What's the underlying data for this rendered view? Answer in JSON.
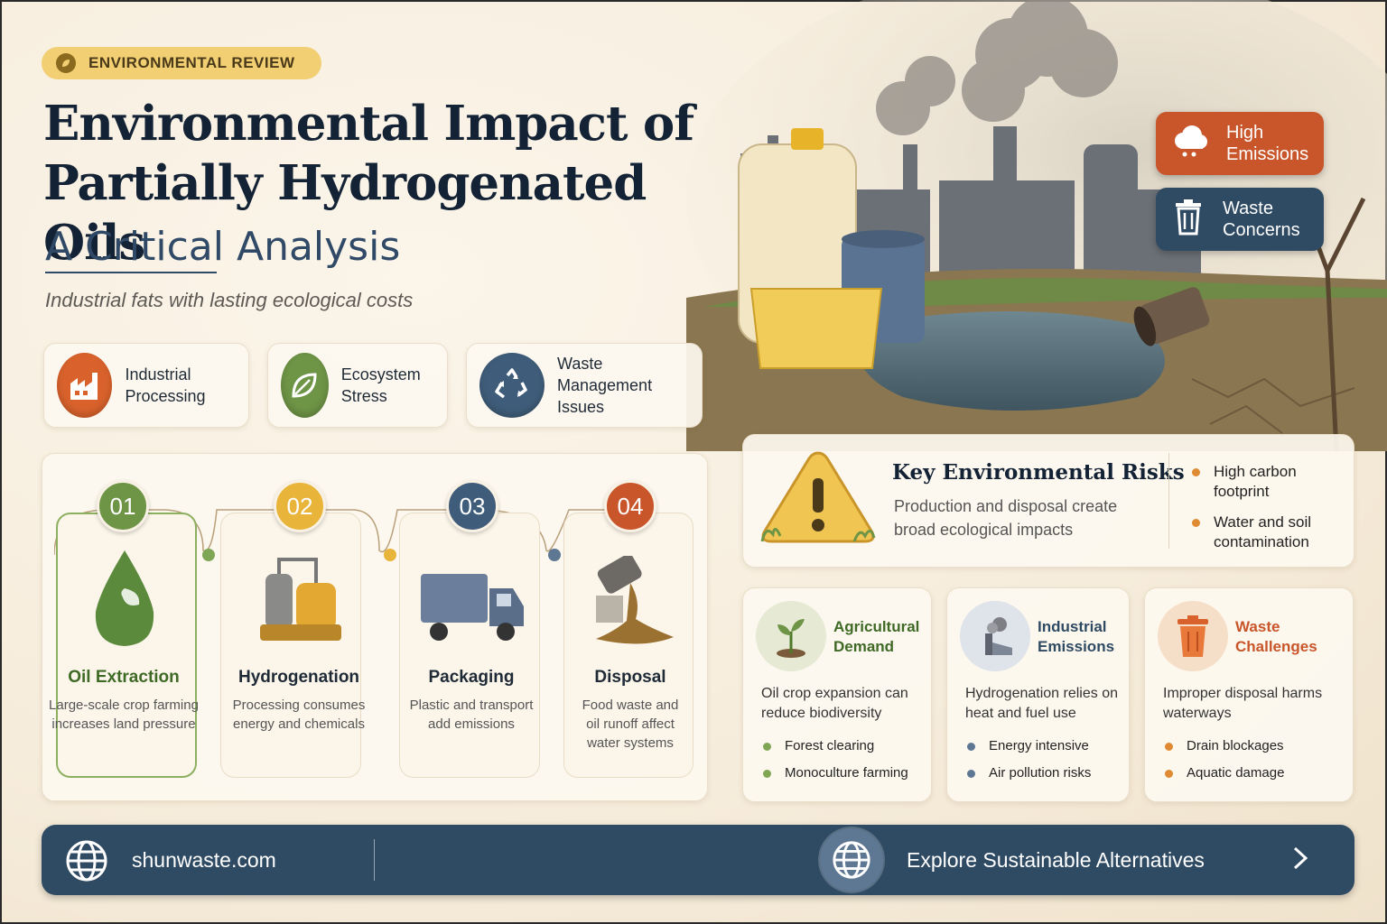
{
  "badge": {
    "label": "ENVIRONMENTAL REVIEW",
    "icon": "leaf-icon"
  },
  "title": {
    "line1": "Environmental Impact of",
    "line2": "Partially Hydrogenated Oils",
    "subtitle": "A Critical Analysis",
    "tagline": "Industrial fats with lasting ecological costs"
  },
  "tags": [
    {
      "label_line1": "High",
      "label_line2": "Emissions",
      "icon": "cloud-icon",
      "color": "#c9552a"
    },
    {
      "label_line1": "Waste",
      "label_line2": "Concerns",
      "icon": "trash-icon",
      "color": "#2f4a63"
    }
  ],
  "categories": [
    {
      "line1": "Industrial",
      "line2": "Processing",
      "icon": "factory-icon",
      "color": "#d9622c"
    },
    {
      "line1": "Ecosystem",
      "line2": "Stress",
      "icon": "leaf-icon",
      "color": "#6e9446"
    },
    {
      "line1": "Waste",
      "line2": "Management Issues",
      "icon": "recycle-icon",
      "color": "#3f5d7a"
    }
  ],
  "steps": [
    {
      "number": "01",
      "title": "Oil Extraction",
      "desc": "Large-scale crop farming increases land pressure",
      "icon": "oil-drop-icon",
      "color": "#6e9446",
      "title_color": "#3f6a26"
    },
    {
      "number": "02",
      "title": "Hydrogenation",
      "desc": "Processing consumes energy and chemicals",
      "icon": "reactor-icon",
      "color": "#e9b43a",
      "title_color": "#1f2a37"
    },
    {
      "number": "03",
      "title": "Packaging",
      "desc": "Plastic and transport add emissions",
      "icon": "truck-icon",
      "color": "#3f5d7a",
      "title_color": "#1f2a37"
    },
    {
      "number": "04",
      "title": "Disposal",
      "desc": "Food waste and oil runoff affect water systems",
      "icon": "spill-icon",
      "color": "#c9552a",
      "title_color": "#1f2a37"
    }
  ],
  "risks": {
    "title": "Key Environmental Risks",
    "desc": "Production and disposal create broad ecological impacts",
    "items": [
      "High carbon footprint",
      "Water and soil contamination"
    ],
    "icon": "warning-icon"
  },
  "impacts": [
    {
      "line1": "Agricultural",
      "line2": "Demand",
      "desc": "Oil crop expansion can reduce biodiversity",
      "items": [
        "Forest clearing",
        "Monoculture farming"
      ],
      "icon": "sprout-icon",
      "color": "#3f6a26",
      "dot": "#7fa655"
    },
    {
      "line1": "Industrial",
      "line2": "Emissions",
      "desc": "Hydrogenation relies on heat and fuel use",
      "items": [
        "Energy intensive",
        "Air pollution risks"
      ],
      "icon": "smokestack-icon",
      "color": "#2f4a63",
      "dot": "#5e7893"
    },
    {
      "line1": "Waste",
      "line2": "Challenges",
      "desc": "Improper disposal harms waterways",
      "items": [
        "Drain blockages",
        "Aquatic damage"
      ],
      "icon": "trash-icon",
      "color": "#c9552a",
      "dot": "#e08a34"
    }
  ],
  "footer": {
    "site": "shunwaste.com",
    "cta": "Explore Sustainable Alternatives",
    "icon": "globe-icon"
  }
}
